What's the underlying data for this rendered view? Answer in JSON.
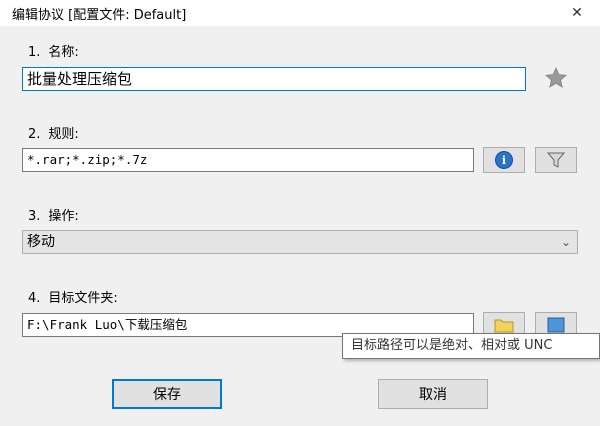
{
  "window": {
    "title": "编辑协议 [配置文件: Default]",
    "close_glyph": "✕"
  },
  "name_section": {
    "number": "1.",
    "label": "名称:",
    "value": "批量处理压缩包"
  },
  "rule_section": {
    "number": "2.",
    "label": "规则:",
    "value": "*.rar;*.zip;*.7z"
  },
  "action_section": {
    "number": "3.",
    "label": "操作:",
    "selected": "移动"
  },
  "folder_section": {
    "number": "4.",
    "label": "目标文件夹:",
    "value": "F:\\Frank Luo\\下载压缩包"
  },
  "tooltip": {
    "text": "目标路径可以是绝对、相对或 UNC"
  },
  "buttons": {
    "save": "保存",
    "cancel": "取消"
  },
  "icons": {
    "favorite": "star-icon",
    "info": "info-icon",
    "filter": "filter-icon",
    "browse": "folder-icon",
    "extra": "window-icon"
  },
  "colors": {
    "focus_border": "#0078d7",
    "info_blue": "#2a73c8",
    "window_bg": "#f0f0f0"
  }
}
